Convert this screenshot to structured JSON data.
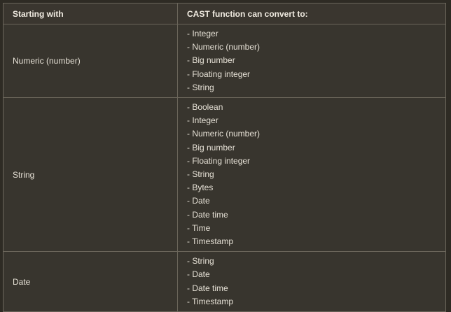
{
  "table": {
    "headers": {
      "starting_with": "Starting with",
      "cast_to": "CAST function can convert to:"
    },
    "rows": [
      {
        "from": "Numeric (number)",
        "to": [
          "- Integer",
          "- Numeric (number)",
          "- Big number",
          "- Floating integer",
          "- String"
        ]
      },
      {
        "from": "String",
        "to": [
          "- Boolean",
          "- Integer",
          "- Numeric (number)",
          "- Big number",
          "- Floating integer",
          "- String",
          "- Bytes",
          "- Date",
          "- Date time",
          "- Time",
          "- Timestamp"
        ]
      },
      {
        "from": "Date",
        "to": [
          "- String",
          "- Date",
          "- Date time",
          "- Timestamp"
        ]
      }
    ]
  }
}
